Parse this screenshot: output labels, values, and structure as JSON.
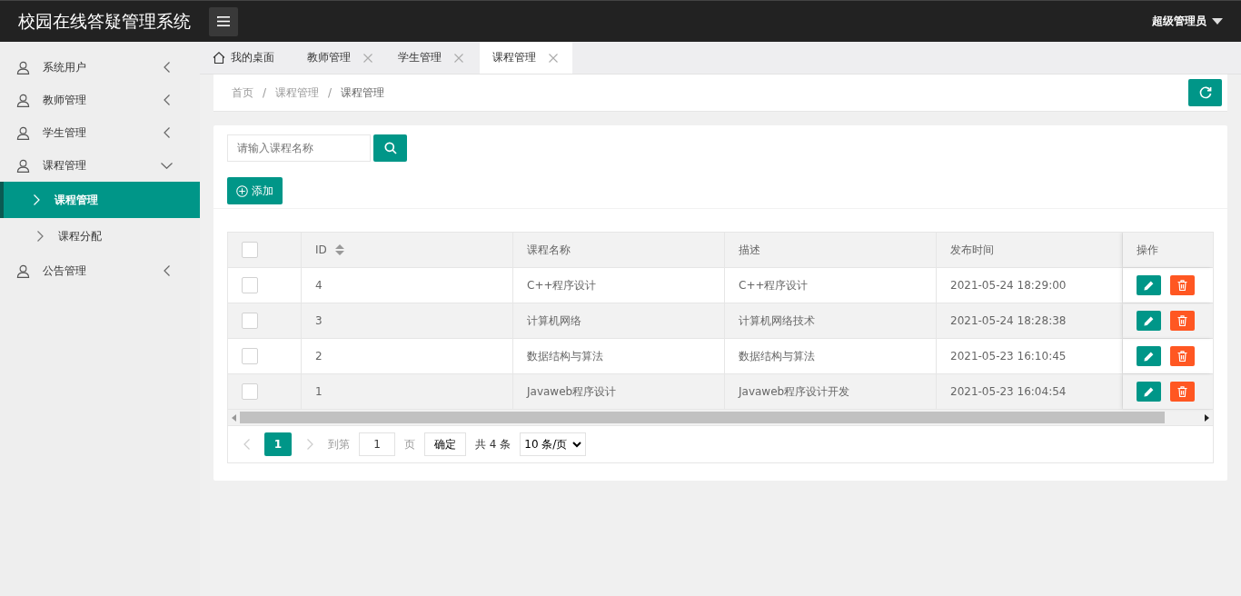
{
  "header": {
    "title": "校园在线答疑管理系统",
    "user": "超级管理员"
  },
  "sidebar": {
    "items": [
      {
        "label": "系统用户",
        "expanded": false
      },
      {
        "label": "教师管理",
        "expanded": false
      },
      {
        "label": "学生管理",
        "expanded": false
      },
      {
        "label": "课程管理",
        "expanded": true,
        "children": [
          {
            "label": "课程管理",
            "selected": true
          },
          {
            "label": "课程分配",
            "selected": false
          }
        ]
      },
      {
        "label": "公告管理",
        "expanded": false
      }
    ]
  },
  "tabs": [
    {
      "label": "我的桌面",
      "kind": "home",
      "selected": false
    },
    {
      "label": "教师管理",
      "kind": "page",
      "selected": false
    },
    {
      "label": "学生管理",
      "kind": "page",
      "selected": false
    },
    {
      "label": "课程管理",
      "kind": "page",
      "selected": true
    }
  ],
  "breadcrumb": {
    "items": [
      "首页",
      "课程管理",
      "课程管理"
    ],
    "separator": "/"
  },
  "search": {
    "placeholder": "请输入课程名称"
  },
  "add_button": "添加",
  "table": {
    "header_checked": false,
    "columns": [
      {
        "label": "ID",
        "sortable": true
      },
      {
        "label": "课程名称",
        "sortable": false
      },
      {
        "label": "描述",
        "sortable": false
      },
      {
        "label": "发布时间",
        "sortable": false
      },
      {
        "label": "操作",
        "sortable": false
      }
    ],
    "rows": [
      {
        "checked": false,
        "cells": [
          "4",
          "C++程序设计",
          "C++程序设计",
          "2021-05-24 18:29:00"
        ]
      },
      {
        "checked": false,
        "cells": [
          "3",
          "计算机网络",
          "计算机网络技术",
          "2021-05-24 18:28:38"
        ]
      },
      {
        "checked": false,
        "cells": [
          "2",
          "数据结构与算法",
          "数据结构与算法",
          "2021-05-23 16:10:45"
        ]
      },
      {
        "checked": false,
        "cells": [
          "1",
          "Javaweb程序设计",
          "Javaweb程序设计开发",
          "2021-05-23 16:04:54"
        ]
      }
    ]
  },
  "pager": {
    "prev": {
      "disabled": true
    },
    "pages": [
      {
        "label": "1",
        "selected": true
      }
    ],
    "next": {
      "disabled": true
    },
    "goto_label": "到第",
    "page_value": "1",
    "page_unit": "页",
    "confirm": "确定",
    "total": "共 4 条",
    "page_size": "10 条/页"
  }
}
